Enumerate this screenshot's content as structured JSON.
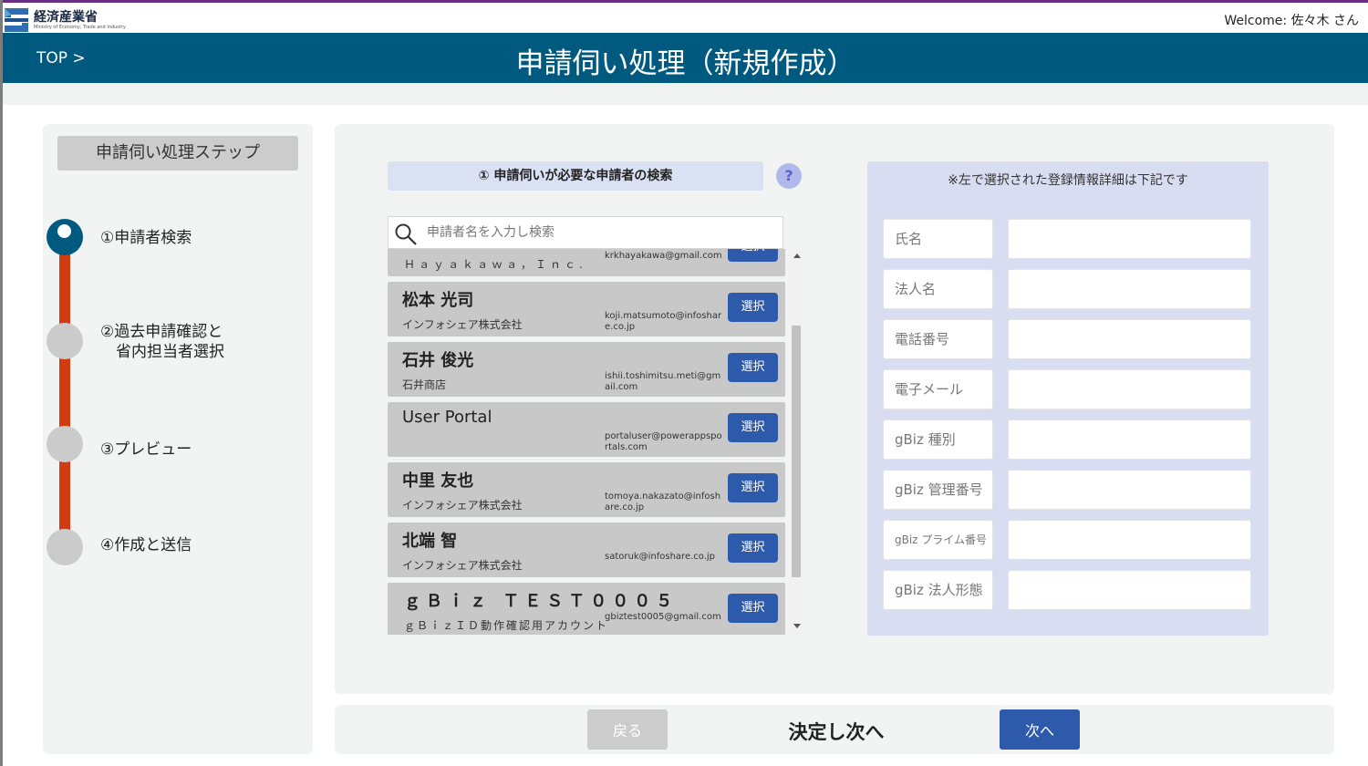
{
  "header": {
    "logo_text": "経済産業省",
    "logo_subtext": "Ministry of Economy, Trade and Industry",
    "welcome": "Welcome: 佐々木 さん",
    "top_link": "TOP >",
    "page_title": "申請伺い処理（新規作成）"
  },
  "steps": {
    "title": "申請伺い処理ステップ",
    "items": [
      {
        "label": "①申請者検索",
        "active": true
      },
      {
        "label": "②過去申請確認と\n　省内担当者選択",
        "active": false
      },
      {
        "label": "③プレビュー",
        "active": false
      },
      {
        "label": "④作成と送信",
        "active": false
      }
    ]
  },
  "search": {
    "header": "① 申請伺いが必要な申請者の検索",
    "help_icon": "?",
    "placeholder": "申請者名を入力し検索",
    "select_label": "選択",
    "results": [
      {
        "name": "",
        "company": "Ｈａｙａｋａｗａ，Ｉｎｃ.",
        "email": "krkhayakawa@gmail.com"
      },
      {
        "name": "松本 光司",
        "company": "インフォシェア株式会社",
        "email": "koji.matsumoto@infoshare.co.jp"
      },
      {
        "name": "石井 俊光",
        "company": "石井商店",
        "email": "ishii.toshimitsu.meti@gmail.com"
      },
      {
        "name": "User Portal",
        "company": "",
        "email": "portaluser@powerappsportals.com"
      },
      {
        "name": "中里 友也",
        "company": "インフォシェア株式会社",
        "email": "tomoya.nakazato@infoshare.co.jp"
      },
      {
        "name": "北端 智",
        "company": "インフォシェア株式会社",
        "email": "satoruk@infoshare.co.jp"
      },
      {
        "name": "ｇＢｉｚ ＴＥＳＴ０００５",
        "company": "ｇＢｉｚＩＤ動作確認用アカウント",
        "email": "gbiztest0005@gmail.com"
      }
    ]
  },
  "detail": {
    "note": "※左で選択された登録情報詳細は下記です",
    "fields": [
      {
        "label": "氏名",
        "value": ""
      },
      {
        "label": "法人名",
        "value": ""
      },
      {
        "label": "電話番号",
        "value": ""
      },
      {
        "label": "電子メール",
        "value": ""
      },
      {
        "label": "gBiz 種別",
        "value": ""
      },
      {
        "label": "gBiz 管理番号",
        "value": ""
      },
      {
        "label": "gBiz プライム番号",
        "value": ""
      },
      {
        "label": "gBiz 法人形態",
        "value": ""
      }
    ]
  },
  "footer": {
    "back_label": "戻る",
    "decide_label": "決定し次へ",
    "next_label": "次へ"
  },
  "colors": {
    "titlebar": "#005a80",
    "step_line": "#d13b12",
    "button": "#2e5aac"
  }
}
